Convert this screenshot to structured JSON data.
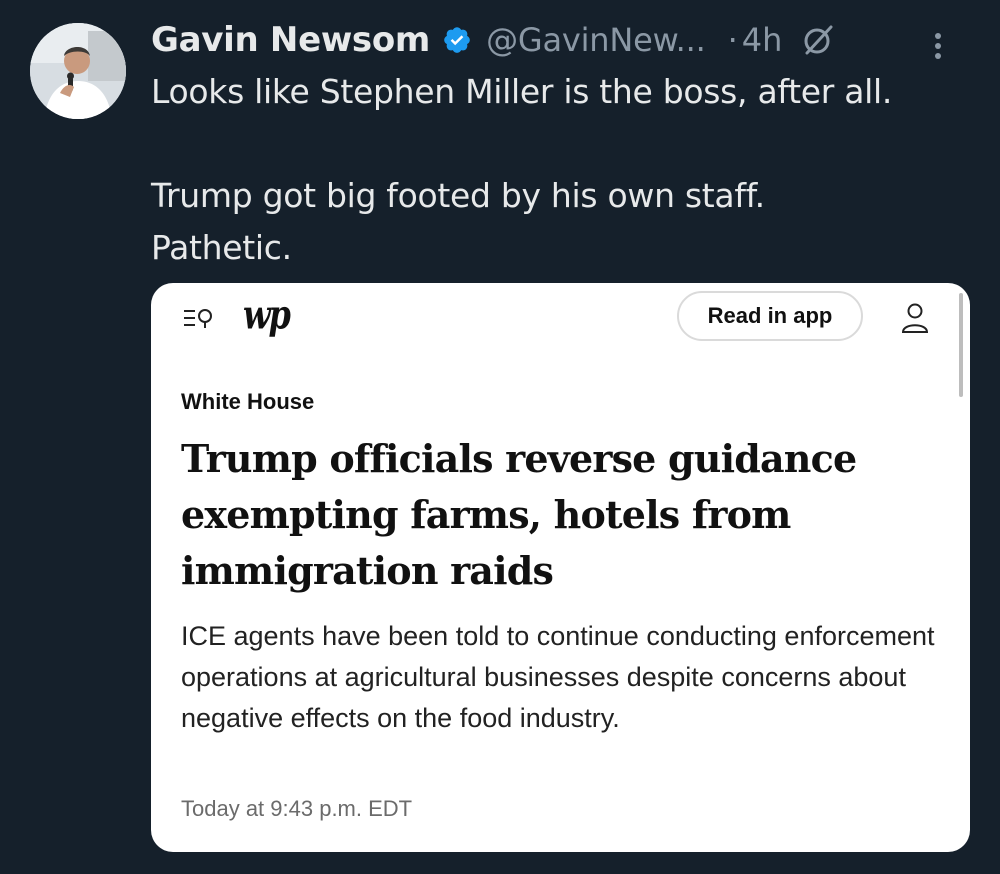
{
  "tweet": {
    "author_name": "Gavin Newsom",
    "handle": "@GavinNew...",
    "separator": "·",
    "time": "4h",
    "text_lines": [
      "Looks like Stephen Miller is the boss, after all.",
      "Trump got big footed by his own staff.",
      "Pathetic."
    ],
    "icons": {
      "verified": "verified-badge-icon",
      "grok": "grok-icon",
      "more": "more-options-icon"
    },
    "colors": {
      "background": "#15202b",
      "text": "#e7e9ea",
      "muted": "#8b98a5",
      "verified": "#1d9bf0"
    }
  },
  "article_card": {
    "logo_text": "wp",
    "read_in_app_label": "Read in app",
    "section": "White House",
    "headline": "Trump officials reverse guidance exempting farms, hotels from immigration raids",
    "summary": "ICE agents have been told to continue conducting enforcement operations at agricultural businesses despite concerns about negative effects on the food industry.",
    "timestamp": "Today at 9:43 p.m. EDT",
    "icons": {
      "menu": "menu-search-icon",
      "account": "user-account-icon"
    }
  }
}
